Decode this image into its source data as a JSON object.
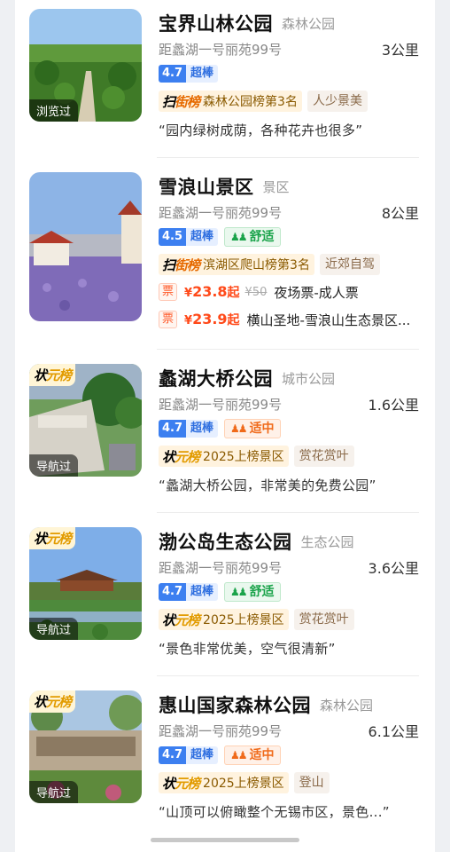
{
  "origin_label": "距蠡湖一号丽苑99号",
  "cards": [
    {
      "title": "宝界山林公园",
      "type": "森林公园",
      "distance": "3公里",
      "score": "4.7",
      "score_word": "超棒",
      "rank_logo_a": "扫",
      "rank_logo_b": "街榜",
      "rank_text": "森林公园榜第3名",
      "rank_extra": "人少景美",
      "quote": "“园内绿树成荫，各种花卉也很多”",
      "thumb_badge": "浏览过"
    },
    {
      "title": "雪浪山景区",
      "type": "景区",
      "distance": "8公里",
      "score": "4.5",
      "score_word": "超棒",
      "crowd_icon": "people-icon",
      "crowd": "舒适",
      "rank_logo_a": "扫",
      "rank_logo_b": "街榜",
      "rank_text": "滨湖区爬山榜第3名",
      "rank_extra": "近郊自驾",
      "tickets": [
        {
          "badge": "票",
          "currency": "¥",
          "price": "23.8",
          "suffix": "起",
          "old": "¥50",
          "name": "夜场票-成人票"
        },
        {
          "badge": "票",
          "currency": "¥",
          "price": "23.9",
          "suffix": "起",
          "old": "",
          "name": "横山圣地-雪浪山生态景区..."
        }
      ]
    },
    {
      "title": "蠡湖大桥公园",
      "type": "城市公园",
      "distance": "1.6公里",
      "score": "4.7",
      "score_word": "超棒",
      "crowd_icon": "people-icon",
      "crowd": "适中",
      "rank_logo_a": "状",
      "rank_logo_b": "元榜",
      "rank_text": "2025上榜景区",
      "rank_extra": "赏花赏叶",
      "quote": "“蠡湖大桥公园，非常美的免费公园”",
      "thumb_badge": "导航过",
      "thumb_rank_a": "状",
      "thumb_rank_b": "元榜"
    },
    {
      "title": "渤公岛生态公园",
      "type": "生态公园",
      "distance": "3.6公里",
      "score": "4.7",
      "score_word": "超棒",
      "crowd_icon": "people-icon",
      "crowd": "舒适",
      "rank_logo_a": "状",
      "rank_logo_b": "元榜",
      "rank_text": "2025上榜景区",
      "rank_extra": "赏花赏叶",
      "quote": "“景色非常优美，空气很清新”",
      "thumb_badge": "导航过",
      "thumb_rank_a": "状",
      "thumb_rank_b": "元榜"
    },
    {
      "title": "惠山国家森林公园",
      "type": "森林公园",
      "distance": "6.1公里",
      "score": "4.7",
      "score_word": "超棒",
      "crowd_icon": "people-icon",
      "crowd": "适中",
      "rank_logo_a": "状",
      "rank_logo_b": "元榜",
      "rank_text": "2025上榜景区",
      "rank_extra": "登山",
      "quote": "“山顶可以俯瞰整个无锡市区，景色...”",
      "thumb_badge": "导航过",
      "thumb_rank_a": "状",
      "thumb_rank_b": "元榜"
    }
  ],
  "colors": {
    "score_blue": "#3c7ff0",
    "crowd_green": "#1aa34a",
    "crowd_orange": "#f06a1a",
    "price_red": "#ff4a1a",
    "rank_gold": "#e29b00"
  }
}
